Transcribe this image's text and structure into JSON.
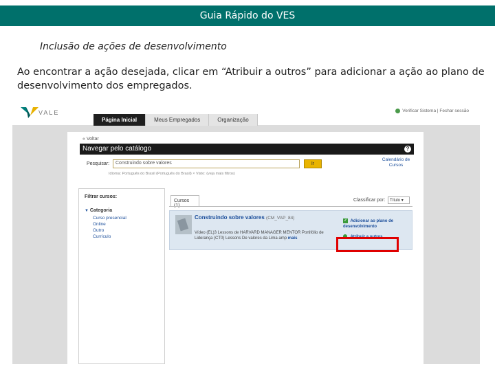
{
  "slide": {
    "header_title": "Guia Rápido do VES",
    "subtitle": "Inclusão de ações de desenvolvimento",
    "instruction": "Ao encontrar a ação desejada, clicar em “Atribuir a outros” para adicionar a ação ao plano de desenvolvimento dos empregados."
  },
  "app": {
    "logo_text": "VALE",
    "user_links": "Verificar Sistema | Fechar sessão",
    "nav_tabs": [
      {
        "label": "Página Inicial",
        "active": true
      },
      {
        "label": "Meus Empregados",
        "active": false
      },
      {
        "label": "Organização",
        "active": false
      }
    ],
    "back_link": "« Voltar",
    "catalog_title": "Navegar pelo catálogo",
    "help_glyph": "?",
    "search": {
      "label": "Pesquisar:",
      "value": "Construindo sobre valores",
      "button": "Ir"
    },
    "calendar_link": "Calendário de Cursos",
    "filters_line": "Idioma: Português do Brasil (Português do Brasil) × Visto: (veja mais filtros)"
  },
  "filters": {
    "title": "Filtrar cursos:",
    "category_title": "Categoria",
    "items": [
      "Curso presencial",
      "Online",
      "Outro",
      "Currículo"
    ]
  },
  "results": {
    "tab_label": "Cursos (1)",
    "sort_label": "Classificar por:",
    "sort_value": "Título",
    "course": {
      "title": "Construindo sobre valores",
      "code": "(CM_VAP_84)",
      "description": "Vídeo (EL)3 Lessons de HARVARD MANAGER MENTOR Portifólio de Liderança (CT0) Lessons De valores da Lima amp",
      "more": "mais",
      "action_plan": "Adicionar ao plano de desenvolvimento",
      "assign": "Atribuir a outros"
    }
  }
}
